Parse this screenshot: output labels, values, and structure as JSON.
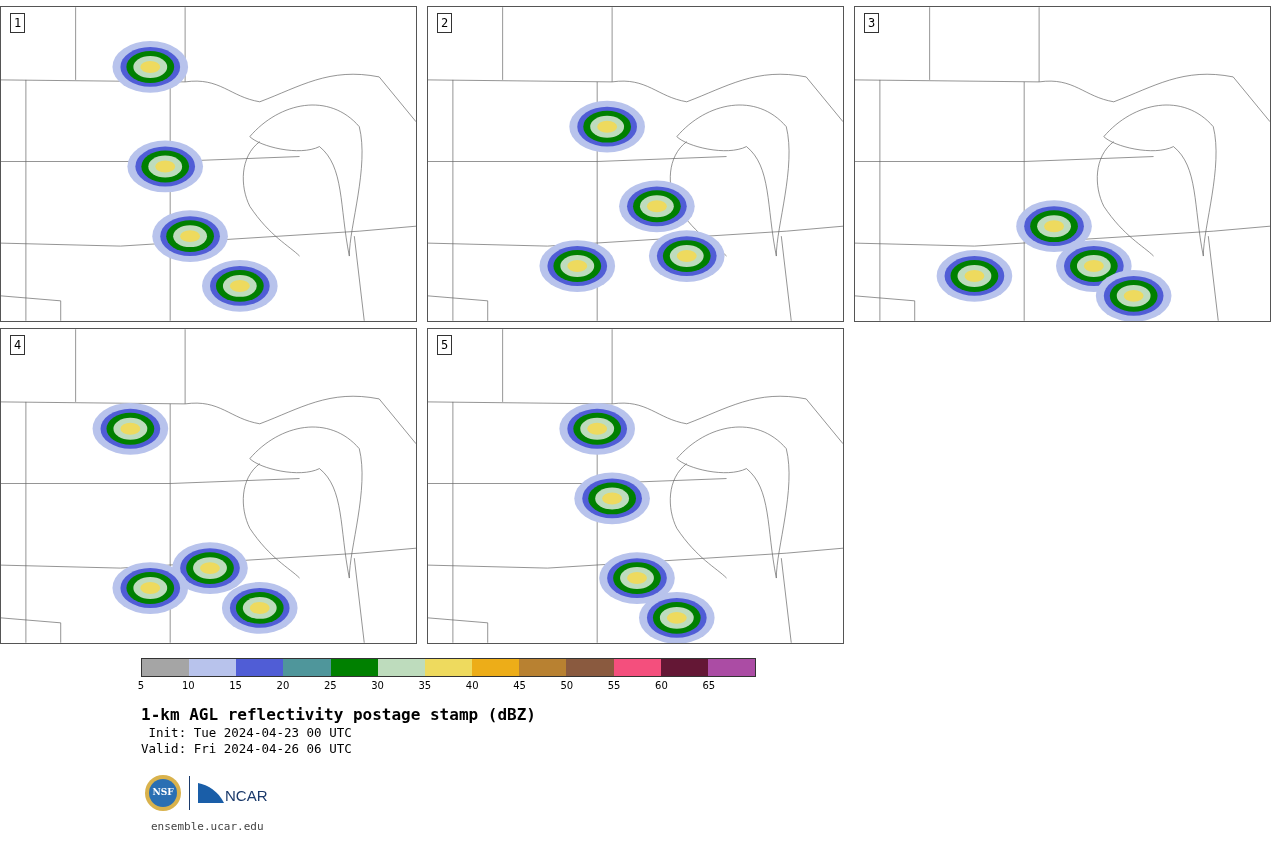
{
  "panels": [
    {
      "label": "1"
    },
    {
      "label": "2"
    },
    {
      "label": "3"
    },
    {
      "label": "4"
    },
    {
      "label": "5"
    }
  ],
  "colorbar": {
    "segments": [
      {
        "color": "#a5a5a5",
        "tick": "5"
      },
      {
        "color": "#b8c3ec",
        "tick": "10"
      },
      {
        "color": "#505dd6",
        "tick": "15"
      },
      {
        "color": "#4f969b",
        "tick": "20"
      },
      {
        "color": "#008000",
        "tick": "25"
      },
      {
        "color": "#bedcbd",
        "tick": "30"
      },
      {
        "color": "#eeda5e",
        "tick": "35"
      },
      {
        "color": "#edad18",
        "tick": "40"
      },
      {
        "color": "#b88131",
        "tick": "45"
      },
      {
        "color": "#8a5a3f",
        "tick": "50"
      },
      {
        "color": "#f44f7d",
        "tick": "55"
      },
      {
        "color": "#641735",
        "tick": "60"
      },
      {
        "color": "#ab4ca4",
        "tick": "65"
      }
    ]
  },
  "title": "1-km AGL reflectivity postage stamp (dBZ)",
  "init": " Init: Tue 2024-04-23 00 UTC",
  "valid": "Valid: Fri 2024-04-26 06 UTC",
  "logos": {
    "nsf": "NSF",
    "ncar": "NCAR"
  },
  "url": "ensemble.ucar.edu"
}
